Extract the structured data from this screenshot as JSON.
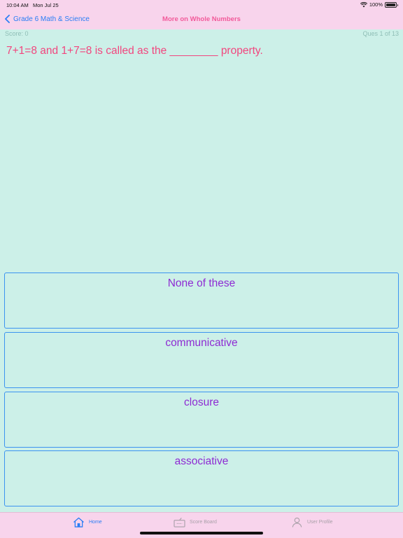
{
  "status": {
    "time": "10:04 AM",
    "date": "Mon Jul 25",
    "battery": "100%",
    "battery_level": 1.0
  },
  "nav": {
    "back_label": "Grade 6 Math & Science",
    "title": "More on Whole Numbers"
  },
  "quiz": {
    "score": "Score: 0",
    "progress": "Ques 1 of 13",
    "question": "7+1=8 and 1+7=8 is called as the ________ property.",
    "options": [
      "None of these",
      "communicative",
      "closure",
      "associative"
    ]
  },
  "tabs": {
    "home": "Home",
    "score_board": "Score Board",
    "user_profile": "User Profile"
  },
  "colors": {
    "background": "#ccf0e8",
    "bars": "#f8d4ec",
    "accent_blue": "#2a7ef5",
    "title_pink": "#f25a9a",
    "question_pink": "#f2467e",
    "option_purple": "#8e2bd3"
  }
}
